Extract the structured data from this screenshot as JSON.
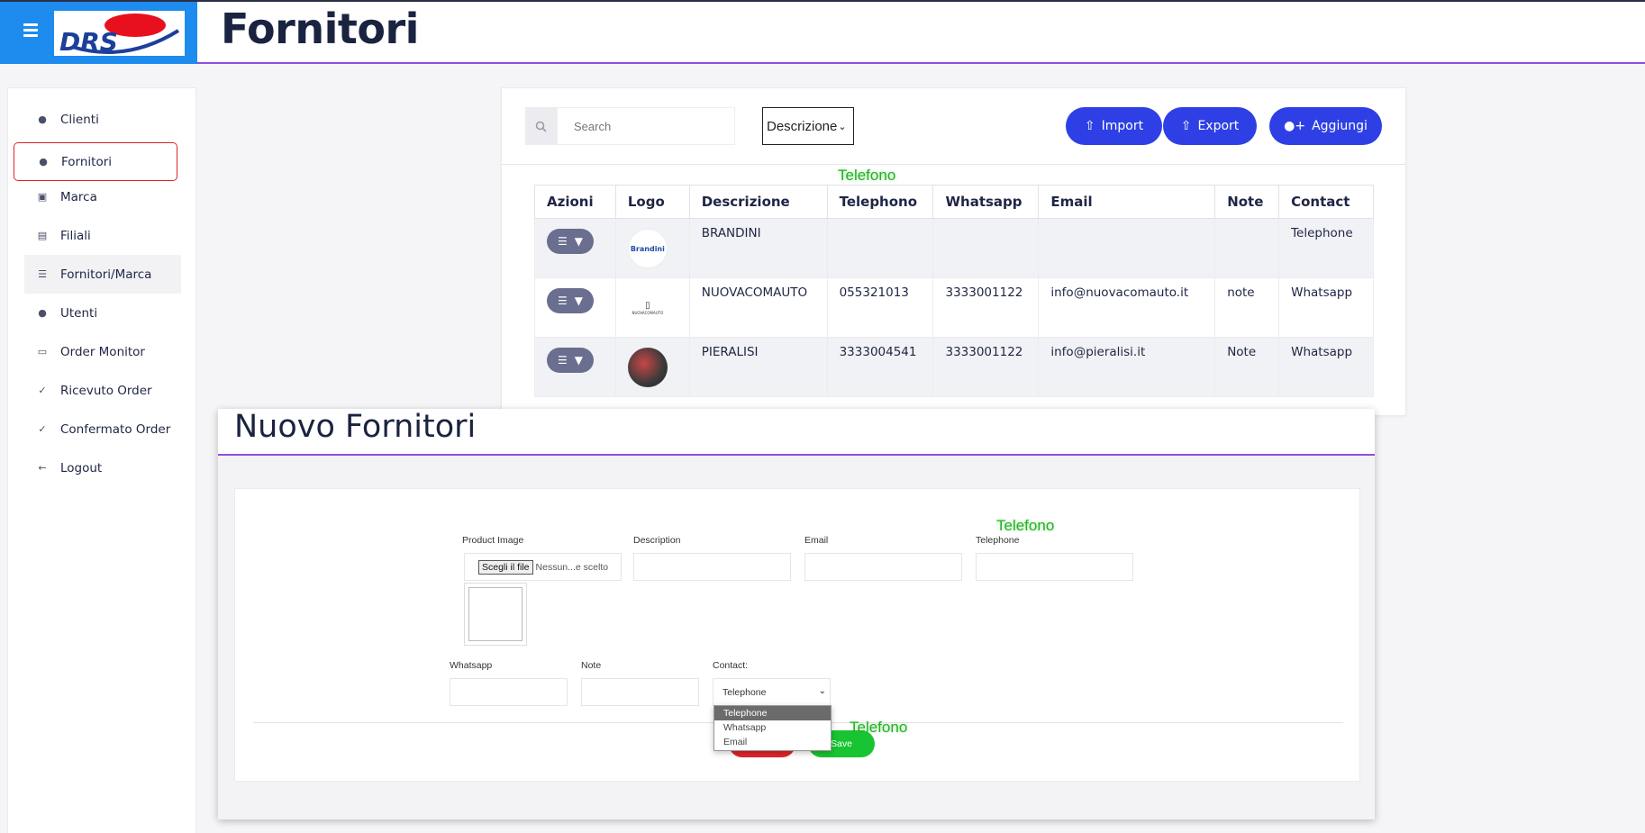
{
  "header": {
    "title": "Fornitori",
    "brand_text": "DRS",
    "brand_color": "#1e8bef",
    "accent_line": "#8e4fe0"
  },
  "sidebar": {
    "items": [
      {
        "label": "Clienti",
        "icon": "user-icon"
      },
      {
        "label": "Fornitori",
        "icon": "user-icon"
      },
      {
        "label": "Marca",
        "icon": "box-icon"
      },
      {
        "label": "Filiali",
        "icon": "id-card-icon"
      },
      {
        "label": "Fornitori/Marca",
        "icon": "list-icon"
      },
      {
        "label": "Utenti",
        "icon": "user-icon"
      },
      {
        "label": "Order Monitor",
        "icon": "monitor-icon"
      },
      {
        "label": "Ricevuto Order",
        "icon": "check-icon"
      },
      {
        "label": "Confermato Order",
        "icon": "check-icon"
      },
      {
        "label": "Logout",
        "icon": "arrow-left-icon"
      }
    ]
  },
  "toolbar": {
    "search_placeholder": "Search",
    "filter_value": "Descrizione",
    "import_label": "Import",
    "export_label": "Export",
    "add_label": "Aggiungi"
  },
  "table": {
    "columns": [
      "Azioni",
      "Logo",
      "Descrizione",
      "Telephono",
      "Whatsapp",
      "Email",
      "Note",
      "Contact"
    ],
    "rows": [
      {
        "logo": "Brandini",
        "descrizione": "BRANDINI",
        "telephono": "",
        "whatsapp": "",
        "email": "",
        "note": "",
        "contact": "Telephone"
      },
      {
        "logo": "NUOVACOMAUTO",
        "descrizione": "NUOVACOMAUTO",
        "telephono": "055321013",
        "whatsapp": "3333001122",
        "email": "info@nuovacomauto.it",
        "note": "note",
        "contact": "Whatsapp"
      },
      {
        "logo": "",
        "descrizione": "PIERALISI",
        "telephono": "3333004541",
        "whatsapp": "3333001122",
        "email": "info@pieralisi.it",
        "note": "Note",
        "contact": "Whatsapp"
      }
    ]
  },
  "overlay_labels": {
    "table_header": "Telefono",
    "form_field": "Telefono",
    "dropdown": "Telefono",
    "color": "#21b21f"
  },
  "modal": {
    "title": "Nuovo Fornitori",
    "fields": {
      "product_image_label": "Product Image",
      "file_button": "Scegli il file",
      "file_status": "Nessun...e scelto",
      "description_label": "Description",
      "email_label": "Email",
      "telephone_label": "Telephone",
      "whatsapp_label": "Whatsapp",
      "note_label": "Note",
      "contact_label": "Contact:",
      "contact_value": "Telephone"
    },
    "contact_options": [
      "Telephone",
      "Whatsapp",
      "Email"
    ],
    "save_label": "Save"
  }
}
